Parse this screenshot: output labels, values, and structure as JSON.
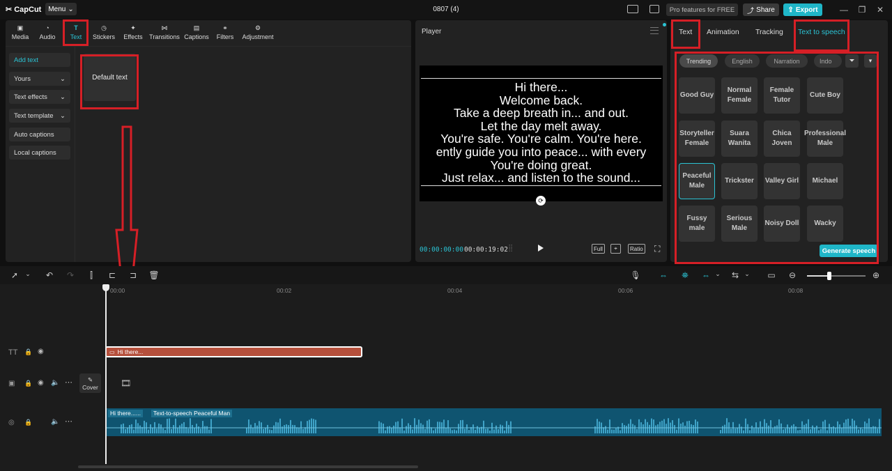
{
  "app": {
    "name": "CapCut",
    "menu_label": "Menu",
    "document_title": "0807 (4)"
  },
  "header": {
    "pro_label": "Pro features for FREE",
    "share_label": "Share",
    "export_label": "Export"
  },
  "toolbar": [
    {
      "label": "Media"
    },
    {
      "label": "Audio"
    },
    {
      "label": "Text"
    },
    {
      "label": "Stickers"
    },
    {
      "label": "Effects"
    },
    {
      "label": "Transitions"
    },
    {
      "label": "Captions"
    },
    {
      "label": "Filters"
    },
    {
      "label": "Adjustment"
    }
  ],
  "text_menu": [
    {
      "label": "Add text"
    },
    {
      "label": "Yours"
    },
    {
      "label": "Text effects"
    },
    {
      "label": "Text template"
    },
    {
      "label": "Auto captions"
    },
    {
      "label": "Local captions"
    }
  ],
  "default_text_label": "Default text",
  "player": {
    "title": "Player",
    "lines": [
      "Hi there...",
      "Welcome back.",
      "Take a deep breath in... and out.",
      "Let the day melt away.",
      "You're safe. You're calm. You're here.",
      "ently guide you into peace... with every",
      "You're doing great.",
      "Just relax... and listen to the sound..."
    ],
    "current_time": "00:00:00:00",
    "total_time": "00:00:19:02",
    "full_label": "Full",
    "ratio_label": "Ratio"
  },
  "right_tabs": [
    {
      "label": "Text"
    },
    {
      "label": "Animation"
    },
    {
      "label": "Tracking"
    },
    {
      "label": "Text to speech"
    }
  ],
  "voice_filters": [
    {
      "label": "Trending"
    },
    {
      "label": "English"
    },
    {
      "label": "Narration"
    },
    {
      "label": "Indo"
    }
  ],
  "voices": [
    "Good Guy",
    "Normal Female",
    "Female Tutor",
    "Cute Boy",
    "Storyteller Female",
    "Suara Wanita",
    "Chica Joven",
    "Professional Male",
    "Peaceful Male",
    "Trickster",
    "Valley Girl",
    "Michael",
    "Fussy male",
    "Serious Male",
    "Noisy Doll",
    "Wacky"
  ],
  "selected_voice": "Peaceful Male",
  "generate_label": "Generate speech",
  "timeline": {
    "ruler": [
      "00:00",
      "00:02",
      "00:04",
      "00:06",
      "00:08"
    ],
    "text_clip_label": "Hi there...",
    "cover_label": "Cover",
    "audio_clip_label1": "Hi there......",
    "audio_clip_label2": "Text-to-speech Peaceful Man",
    "zoom_level": 0.38
  },
  "colors": {
    "accent": "#1fb6c8",
    "highlight": "#d61f26",
    "text_clip": "#b5503c",
    "audio_clip": "#0f5470"
  }
}
